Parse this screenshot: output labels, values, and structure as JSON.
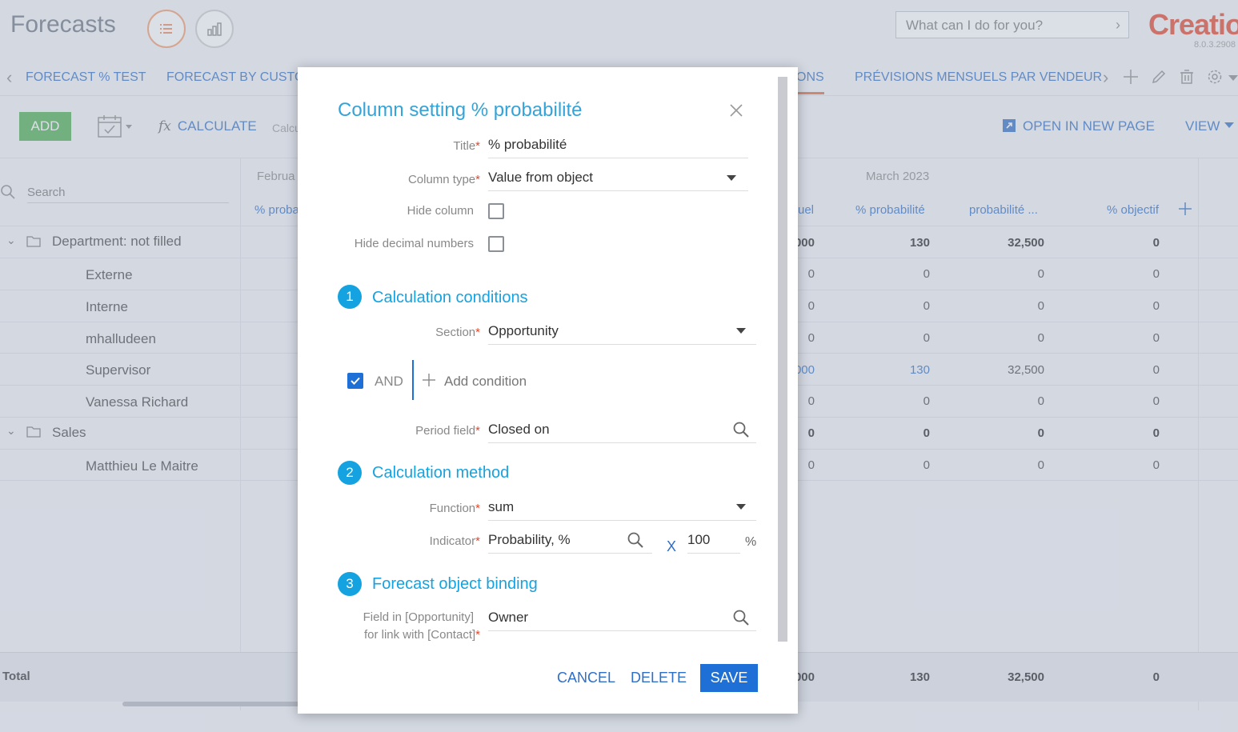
{
  "app": {
    "title": "Forecasts",
    "command_placeholder": "What can I do for you?",
    "logo": "Creatio",
    "version": "8.0.3.2908"
  },
  "tabs": [
    {
      "label": "FORECAST % TEST"
    },
    {
      "label": "FORECAST BY CUSTOM"
    },
    {
      "label": "ONS"
    },
    {
      "label": "PRÉVISIONS MENSUELS PAR VENDEUR"
    }
  ],
  "toolbar": {
    "add_label": "ADD",
    "calculate_label": "CALCULATE",
    "calc_hint": "Calcu",
    "open_new_page_label": "OPEN IN NEW PAGE",
    "view_label": "VIEW"
  },
  "grid": {
    "search_placeholder": "Search",
    "months": {
      "left": "Februa",
      "right": "March 2023"
    },
    "headers": {
      "left_col": "% proba",
      "c1": "uel",
      "c2": "% probabilité",
      "c3": "probabilité ...",
      "c4": "% objectif"
    },
    "rows": [
      {
        "label": "Department: not filled",
        "group": true,
        "values": [
          "000",
          "130",
          "32,500",
          "0"
        ]
      },
      {
        "label": "Externe",
        "group": false,
        "values": [
          "0",
          "0",
          "0",
          "0"
        ]
      },
      {
        "label": "Interne",
        "group": false,
        "values": [
          "0",
          "0",
          "0",
          "0"
        ]
      },
      {
        "label": "mhalludeen",
        "group": false,
        "values": [
          "0",
          "0",
          "0",
          "0"
        ]
      },
      {
        "label": "Supervisor",
        "group": false,
        "values": [
          "000",
          "130",
          "32,500",
          "0"
        ]
      },
      {
        "label": "Vanessa Richard",
        "group": false,
        "values": [
          "0",
          "0",
          "0",
          "0"
        ]
      },
      {
        "label": "Sales",
        "group": true,
        "values": [
          "0",
          "0",
          "0",
          "0"
        ]
      },
      {
        "label": "Matthieu Le Maitre",
        "group": false,
        "values": [
          "0",
          "0",
          "0",
          "0"
        ]
      }
    ],
    "total": {
      "label": "Total",
      "values": [
        "000",
        "130",
        "32,500",
        "0"
      ]
    }
  },
  "modal": {
    "title": "Column setting % probabilité",
    "fields": {
      "title_label": "Title",
      "title_value": "% probabilité",
      "column_type_label": "Column type",
      "column_type_value": "Value from object",
      "hide_column_label": "Hide column",
      "hide_decimal_label": "Hide decimal numbers"
    },
    "sections": [
      {
        "num": "1",
        "title": "Calculation conditions"
      },
      {
        "num": "2",
        "title": "Calculation method"
      },
      {
        "num": "3",
        "title": "Forecast object binding"
      }
    ],
    "conditions": {
      "section_label": "Section",
      "section_value": "Opportunity",
      "and_label": "AND",
      "add_condition_label": "Add condition",
      "period_label": "Period field",
      "period_value": "Closed on"
    },
    "method": {
      "function_label": "Function",
      "function_value": "sum",
      "indicator_label": "Indicator",
      "indicator_value": "Probability, %",
      "multiplier_symbol": "X",
      "multiplier_value": "100",
      "percent_symbol": "%"
    },
    "binding": {
      "field_label_line1": "Field in [Opportunity]",
      "field_label_line2": "for link with [Contact]",
      "field_value": "Owner"
    },
    "buttons": {
      "cancel": "CANCEL",
      "delete": "DELETE",
      "save": "SAVE"
    }
  },
  "colors": {
    "accent": "#2f6fc6",
    "section": "#14a3e0",
    "add_button": "#4caf50",
    "save_button": "#1e6fd6"
  }
}
